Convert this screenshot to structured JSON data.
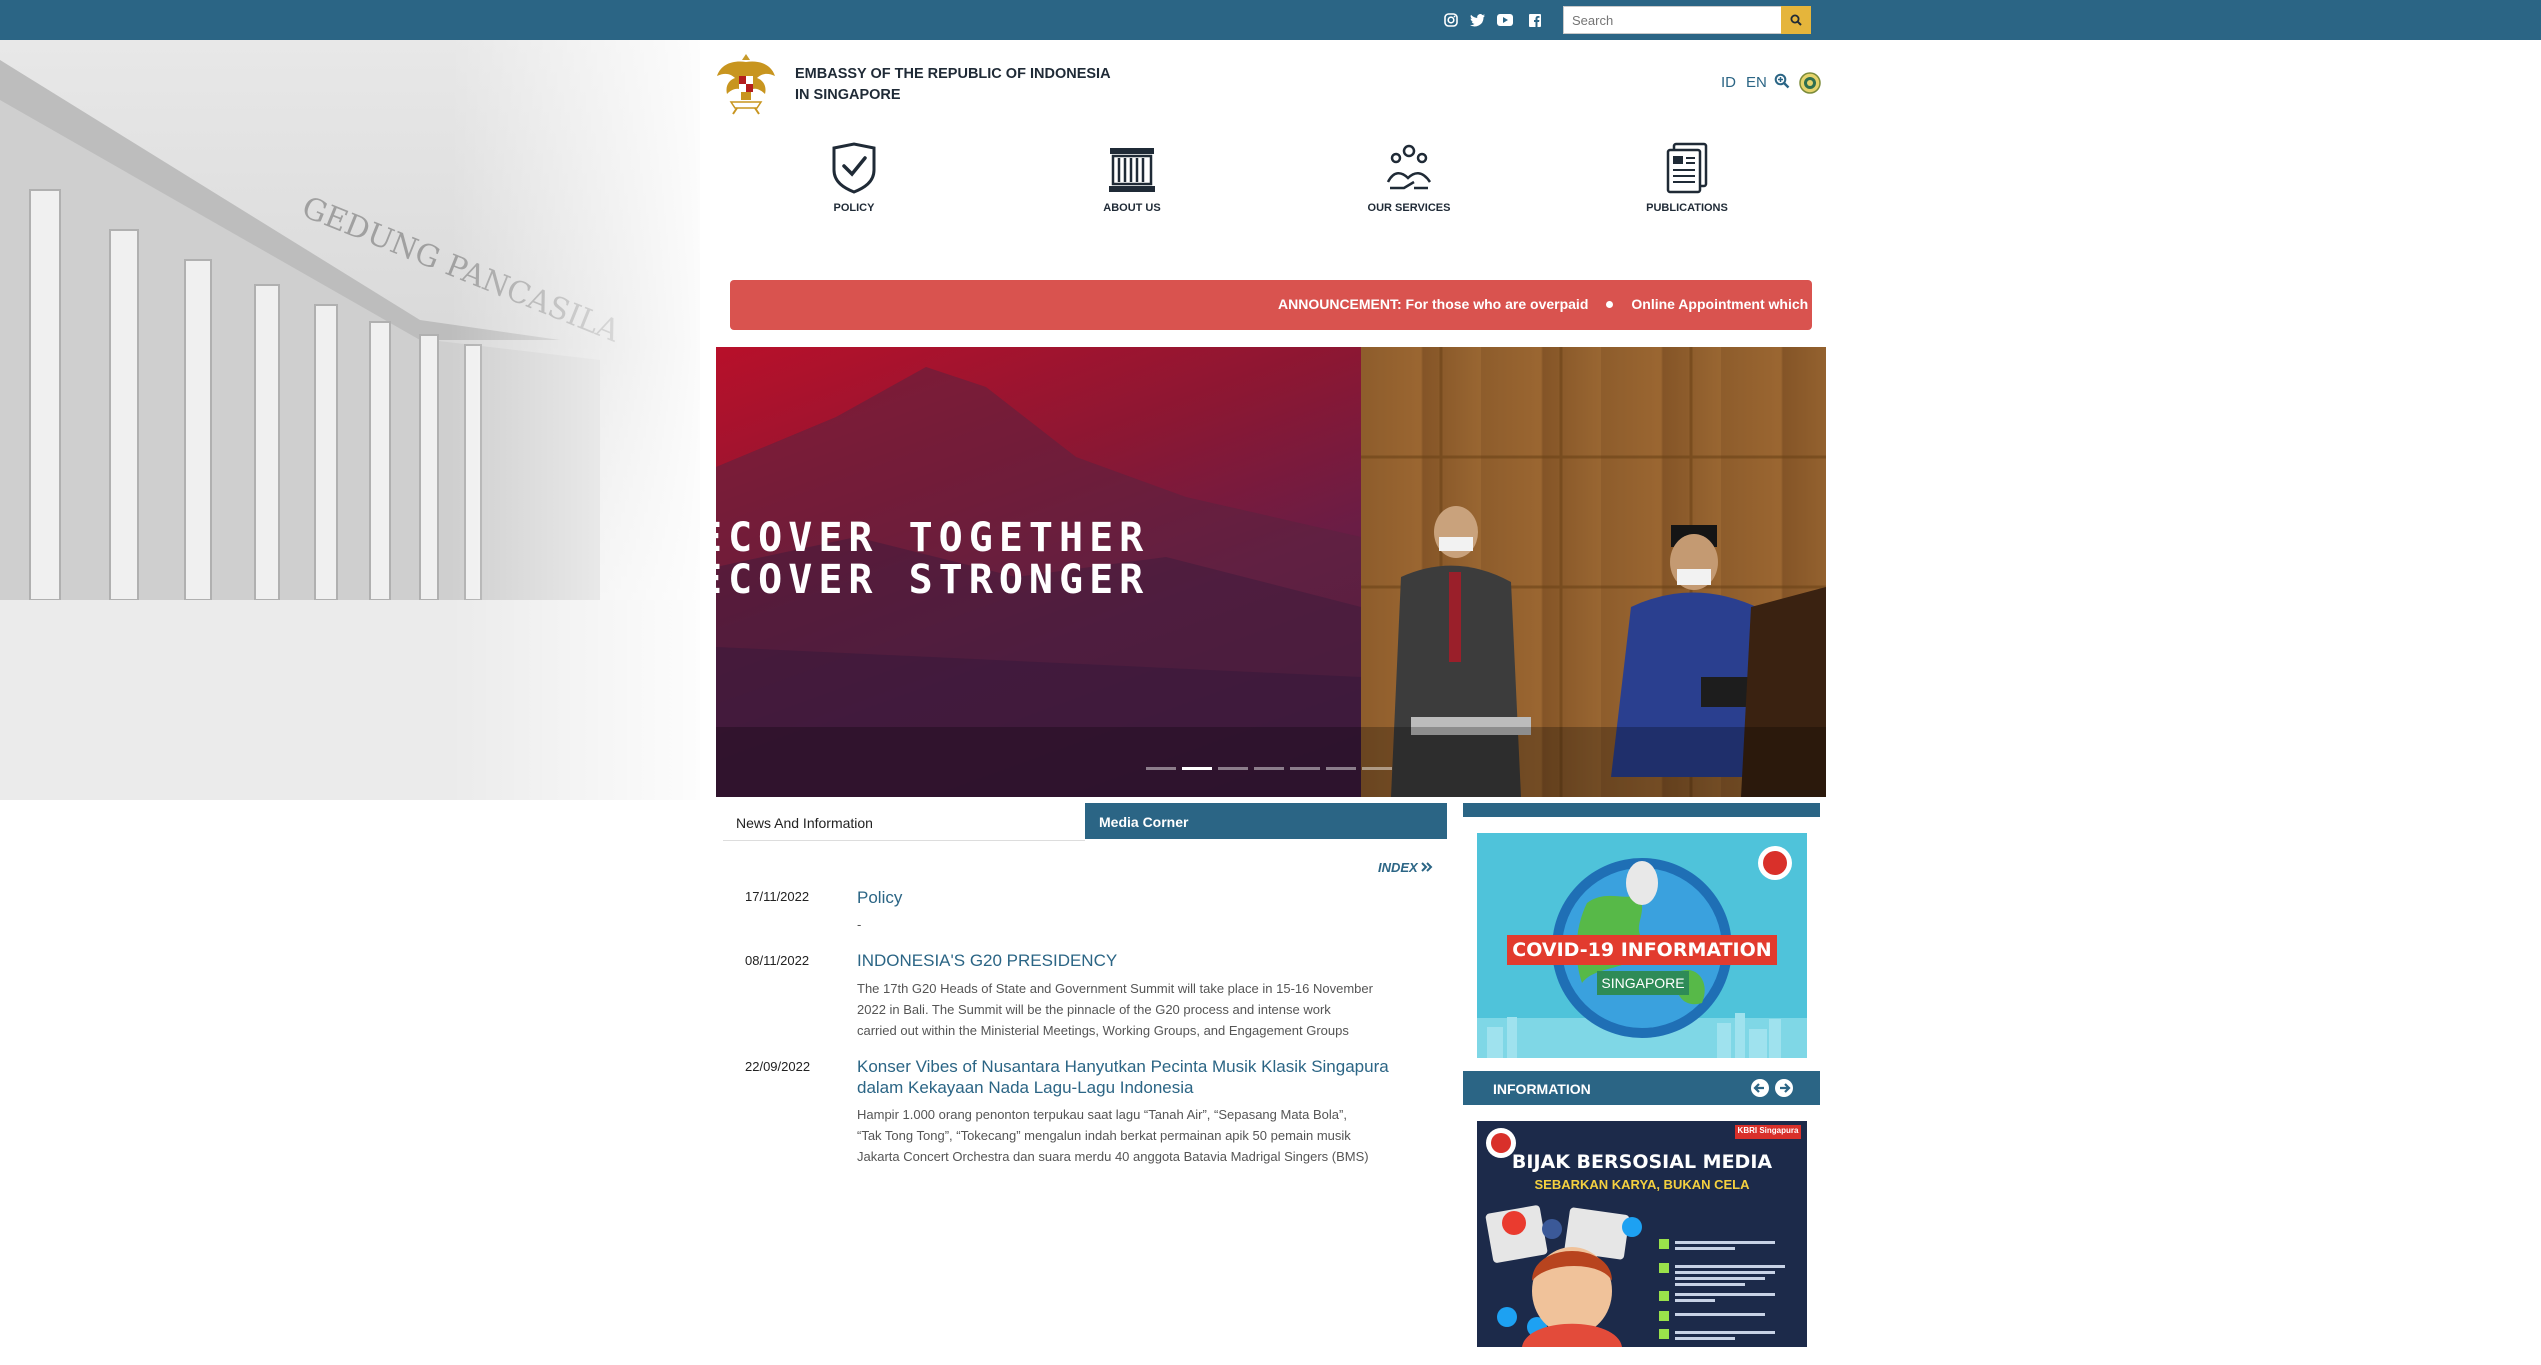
{
  "topbar": {
    "social_icons": [
      "instagram-icon",
      "twitter-icon",
      "youtube-icon",
      "facebook-icon"
    ],
    "search_placeholder": "Search",
    "search_icon": "search-icon"
  },
  "header": {
    "title_line1": "EMBASSY OF THE REPUBLIC OF INDONESIA",
    "title_line2": "IN SINGAPORE",
    "lang_id": "ID",
    "lang_en": "EN"
  },
  "menu": {
    "items": [
      {
        "label": "POLICY",
        "icon": "shield-check-icon"
      },
      {
        "label": "ABOUT US",
        "icon": "building-icon"
      },
      {
        "label": "OUR SERVICES",
        "icon": "helping-hands-icon"
      },
      {
        "label": "PUBLICATIONS",
        "icon": "documents-icon"
      }
    ]
  },
  "announcement": {
    "part1": "ANNOUNCEMENT: For those who are overpaid",
    "part2": "Online Appointment which"
  },
  "slider": {
    "line1": "ECOVER TOGETHER",
    "line2": "ECOVER STRONGER",
    "dot_count": 7,
    "active_dot": 1
  },
  "tabs": {
    "tab1": "News And Information",
    "tab2": "Media Corner"
  },
  "index_link": "INDEX",
  "news": [
    {
      "date": "17/11/2022",
      "title": "Policy",
      "desc": "-"
    },
    {
      "date": "08/11/2022",
      "title": "INDONESIA'S G20 PRESIDENCY",
      "desc1": "The 17th G20 Heads of State and Government Summit will take place in 15-16 November",
      "desc2": "2022 in Bali. The Summit will be the pinnacle of the G20 process and intense work",
      "desc3": "carried out within the Ministerial Meetings, Working Groups, and Engagement Groups"
    },
    {
      "date": "22/09/2022",
      "title1": "Konser Vibes of Nusantara Hanyutkan Pecinta Musik Klasik Singapura",
      "title2": "dalam Kekayaan Nada Lagu-Lagu Indonesia",
      "desc1": "Hampir 1.000 orang penonton terpukau saat lagu “Tanah Air”, “Sepasang Mata Bola”,",
      "desc2": "“Tak Tong Tong”, “Tokecang” mengalun indah berkat permainan apik 50 pemain musik",
      "desc3": "Jakarta Concert Orchestra dan suara merdu 40 anggota Batavia Madrigal Singers (BMS)"
    }
  ],
  "right": {
    "covid_title": "COVID-19 INFORMATION",
    "covid_sub": "SINGAPORE",
    "info_label": "INFORMATION",
    "bijak_title": "BIJAK BERSOSIAL MEDIA",
    "bijak_sub": "SEBARKAN KARYA, BUKAN CELA",
    "bijak_tag": "KBRI Singapura"
  },
  "colors": {
    "brand": "#2b6585",
    "accent": "#e5b53b",
    "announce": "#d9534f"
  }
}
